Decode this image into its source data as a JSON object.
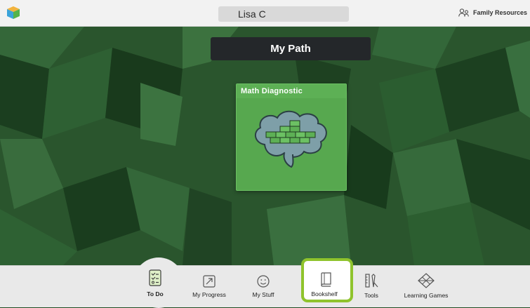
{
  "header": {
    "user_name": "Lisa C",
    "family_resources_label": "Family Resources"
  },
  "main": {
    "path_title": "My Path",
    "card": {
      "title": "Math Diagnostic"
    }
  },
  "nav": {
    "items": [
      {
        "label": "To Do",
        "icon": "checklist-icon",
        "selected": true
      },
      {
        "label": "My Progress",
        "icon": "progress-arrow-icon"
      },
      {
        "label": "My Stuff",
        "icon": "smiley-icon"
      },
      {
        "label": "Bookshelf",
        "icon": "book-icon",
        "highlighted": true
      },
      {
        "label": "Tools",
        "icon": "tools-icon"
      },
      {
        "label": "Learning Games",
        "icon": "games-icon"
      }
    ]
  },
  "colors": {
    "highlight": "#8fc32c",
    "card_green": "#57a84f",
    "background_green": "#264f2a"
  }
}
